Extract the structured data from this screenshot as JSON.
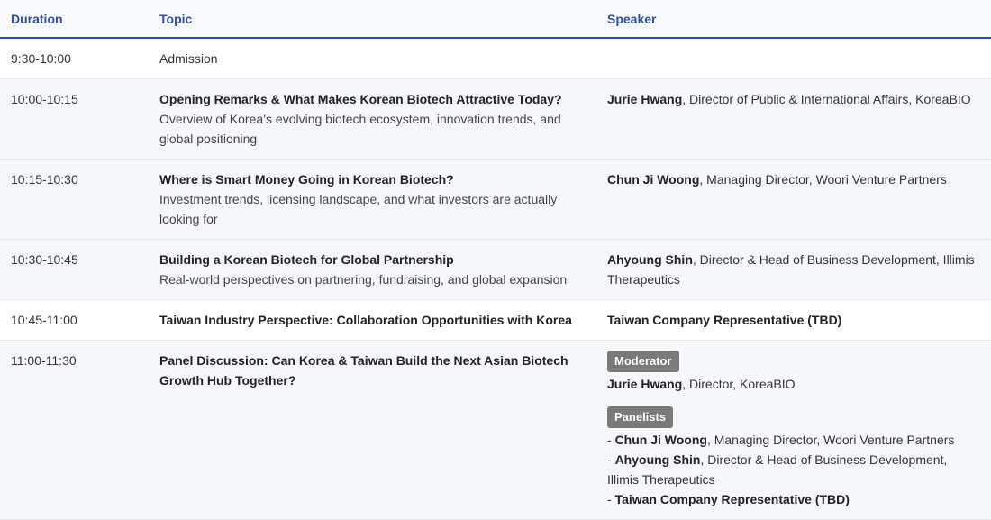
{
  "header": {
    "duration": "Duration",
    "topic": "Topic",
    "speaker": "Speaker"
  },
  "rows": [
    {
      "duration": "9:30-10:00",
      "topic_plain": "Admission"
    },
    {
      "duration": "10:00-10:15",
      "topic_title": "Opening Remarks & What Makes Korean Biotech Attractive Today?",
      "topic_desc": "Overview of Korea’s evolving biotech ecosystem, innovation trends, and global positioning",
      "speaker_name": "Jurie Hwang",
      "speaker_role": ", Director of Public & International Affairs, KoreaBIO"
    },
    {
      "duration": "10:15-10:30",
      "topic_title": "Where is Smart Money Going in Korean Biotech?",
      "topic_desc": "Investment trends, licensing landscape, and what investors are actually looking for",
      "speaker_name": "Chun Ji Woong",
      "speaker_role": ", Managing Director, Woori Venture Partners"
    },
    {
      "duration": "10:30-10:45",
      "topic_title": "Building a Korean Biotech for Global Partnership",
      "topic_desc": "Real-world perspectives on partnering, fundraising, and global expansion",
      "speaker_name": "Ahyoung Shin",
      "speaker_role": ", Director & Head of Business Development, Illimis Therapeutics"
    },
    {
      "duration": "10:45-11:00",
      "topic_title": "Taiwan Industry Perspective: Collaboration Opportunities with Korea",
      "speaker_name": "Taiwan Company Representative (TBD)"
    },
    {
      "duration": "11:00-11:30",
      "topic_title": "Panel Discussion: Can Korea & Taiwan Build the Next Asian Biotech Growth Hub Together?",
      "moderator_label": "Moderator",
      "moderator_name": "Jurie Hwang",
      "moderator_role": ", Director, KoreaBIO",
      "panelists_label": "Panelists",
      "panelists": [
        {
          "prefix": "- ",
          "name": "Chun Ji Woong",
          "role": ", Managing Director, Woori Venture Partners"
        },
        {
          "prefix": "- ",
          "name": "Ahyoung Shin",
          "role": ", Director & Head of Business Development, Illimis Therapeutics"
        },
        {
          "prefix": "- ",
          "name": "Taiwan Company Representative (TBD)",
          "role": ""
        }
      ]
    }
  ],
  "colors": {
    "header_text": "#2f4fa6",
    "header_rule": "#2f4fa6",
    "row_shade": "#f5f7fa",
    "badge_bg": "#7a7a7a"
  }
}
